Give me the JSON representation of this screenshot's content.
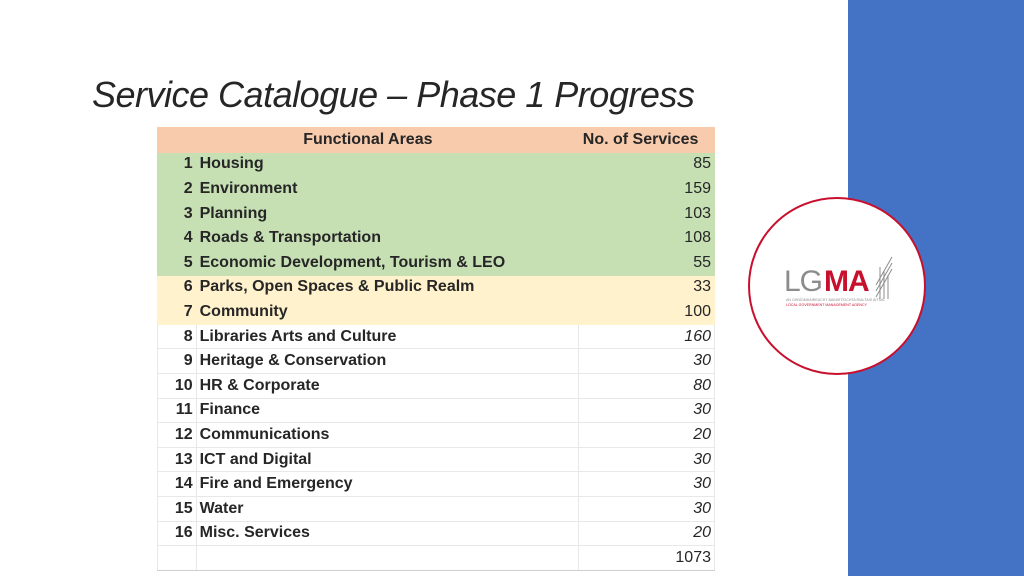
{
  "title": "Service Catalogue – Phase 1 Progress",
  "table": {
    "headers": {
      "area": "Functional Areas",
      "count": "No. of Services"
    },
    "rows": [
      {
        "num": "1",
        "name": "Housing",
        "count": "85"
      },
      {
        "num": "2",
        "name": "Environment",
        "count": "159"
      },
      {
        "num": "3",
        "name": "Planning",
        "count": "103"
      },
      {
        "num": "4",
        "name": "Roads & Transportation",
        "count": "108"
      },
      {
        "num": "5",
        "name": "Economic Development, Tourism & LEO",
        "count": "55"
      },
      {
        "num": "6",
        "name": "Parks, Open Spaces & Public Realm",
        "count": "33"
      },
      {
        "num": "7",
        "name": "Community",
        "count": "100"
      },
      {
        "num": "8",
        "name": "Libraries Arts and Culture",
        "count": "160"
      },
      {
        "num": "9",
        "name": "Heritage & Conservation",
        "count": "30"
      },
      {
        "num": "10",
        "name": "HR & Corporate",
        "count": "80"
      },
      {
        "num": "11",
        "name": "Finance",
        "count": "30"
      },
      {
        "num": "12",
        "name": "Communications",
        "count": "20"
      },
      {
        "num": "13",
        "name": "ICT and Digital",
        "count": "30"
      },
      {
        "num": "14",
        "name": "Fire and Emergency",
        "count": "30"
      },
      {
        "num": "15",
        "name": "Water",
        "count": "30"
      },
      {
        "num": "16",
        "name": "Misc. Services",
        "count": "20"
      }
    ],
    "total": "1073"
  },
  "logo": {
    "text": "LGMA",
    "tagline_line1": "AN GHNÍOMHAIREACHT BAINISTÍOCHTA RIALTAIS ÁITÍUIL",
    "tagline_line2": "LOCAL GOVERNMENT MANAGEMENT AGENCY"
  },
  "colors": {
    "header": "#f8cbad",
    "green_rows": "#c6e0b4",
    "yellow_rows": "#fff2cc",
    "band": "#4472c4",
    "logo_red": "#c8102e",
    "logo_gray": "#8c8c8c"
  }
}
